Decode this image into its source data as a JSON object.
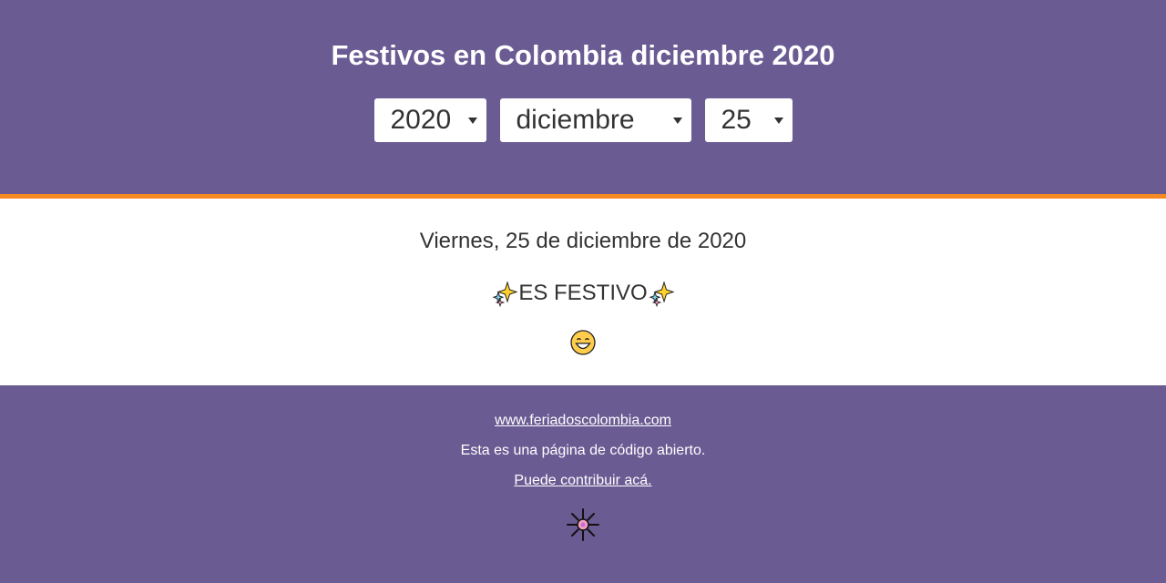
{
  "header": {
    "title": "Festivos en Colombia diciembre 2020",
    "year_select": {
      "value": "2020"
    },
    "month_select": {
      "value": "diciembre"
    },
    "day_select": {
      "value": "25"
    }
  },
  "main": {
    "date_text": "Viernes, 25 de diciembre de 2020",
    "status_text": "ES FESTIVO",
    "status_icon": "sparkles-icon",
    "mood_icon": "grinning-face-icon"
  },
  "footer": {
    "site_link": "www.feriadoscolombia.com",
    "open_source_text": "Esta es una página de código abierto.",
    "contribute_link": "Puede contribuir acá.",
    "bottom_icon": "fireworks-icon"
  },
  "colors": {
    "header_bg": "#6a5b93",
    "accent_border": "#f58a22",
    "footer_bg": "#6a5b93",
    "text": "#333333"
  }
}
